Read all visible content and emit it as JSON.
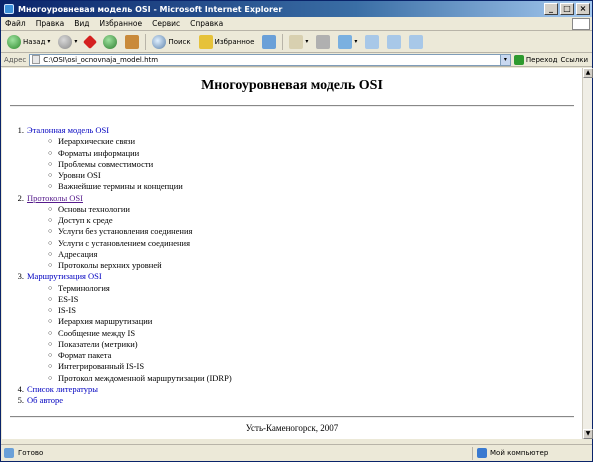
{
  "window": {
    "title": "Многоуровневая модель OSI - Microsoft Internet Explorer",
    "minimize": "_",
    "maximize": "□",
    "close": "×"
  },
  "menu": [
    "Файл",
    "Правка",
    "Вид",
    "Избранное",
    "Сервис",
    "Справка"
  ],
  "toolbar": {
    "back_label": "Назад",
    "search_label": "Поиск",
    "favorites_label": "Избранное"
  },
  "addressbar": {
    "label": "Адрес",
    "url": "C:\\OSI\\osi_ocnovnaja_model.htm",
    "go_label": "Переход",
    "links_label": "Ссылки"
  },
  "page": {
    "title": "Многоуровневая модель OSI",
    "sections": [
      {
        "num": "1.",
        "label": "Эталонная модель OSI",
        "visited": false,
        "items": [
          "Иерархические связи",
          "Форматы информации",
          "Проблемы совместимости",
          "Уровни OSI",
          "Важнейшие термины и концепции"
        ]
      },
      {
        "num": "2.",
        "label": "Протоколы OSI",
        "visited": true,
        "items": [
          "Основы технологии",
          "Доступ к среде",
          "Услуги без установления соединения",
          "Услуги с установлением соединения",
          "Адресация",
          "Протоколы верхних уровней"
        ]
      },
      {
        "num": "3.",
        "label": "Маршрутизация OSI",
        "visited": false,
        "items": [
          "Терминология",
          "ES-IS",
          "IS-IS",
          "Иерархия маршрутизации",
          "Сообщение между IS",
          "Показатели (метрики)",
          "Формат пакета",
          "Интегрированный IS-IS",
          "Протокол междоменной маршрутизации (IDRP)"
        ]
      },
      {
        "num": "4.",
        "label": "Список литературы",
        "visited": false,
        "items": []
      },
      {
        "num": "5.",
        "label": "Об авторе",
        "visited": false,
        "items": []
      }
    ],
    "footer": "Усть-Каменогорск, 2007"
  },
  "status": {
    "text": "Готово",
    "zone": "Мой компьютер"
  }
}
